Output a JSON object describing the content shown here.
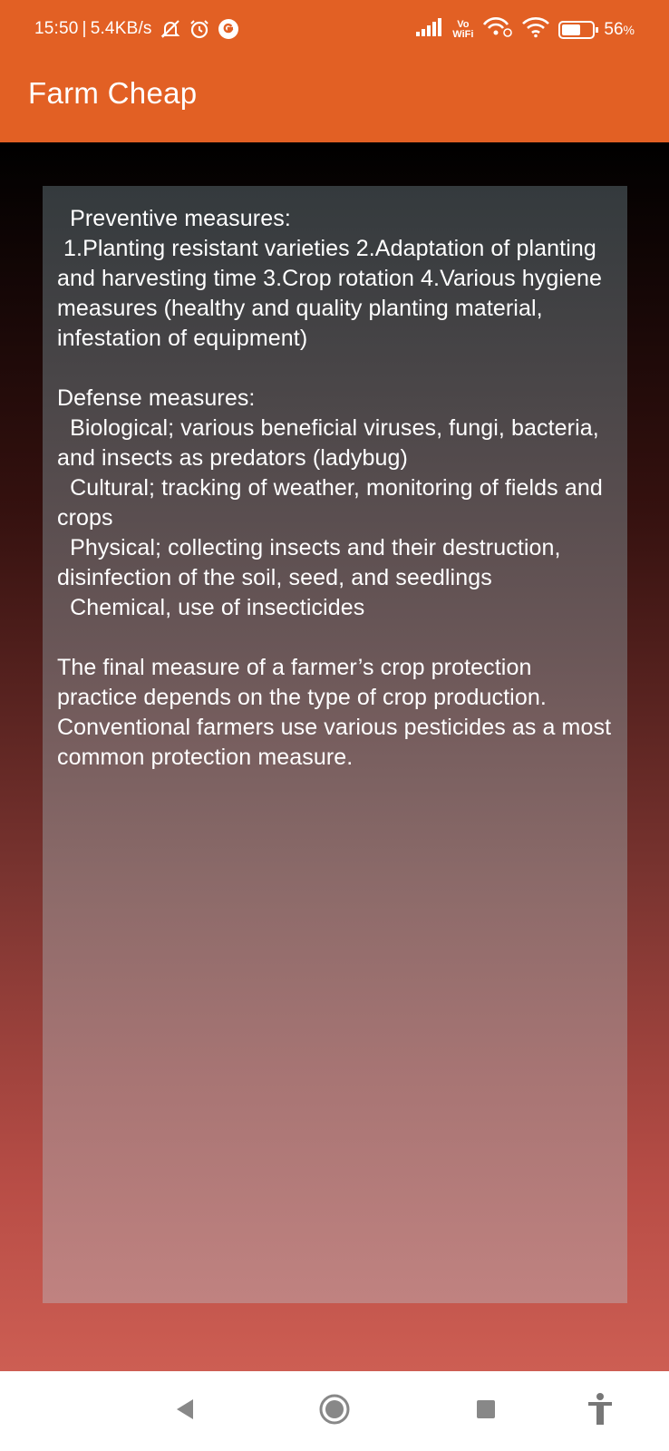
{
  "status_bar": {
    "time": "15:50",
    "separator": "|",
    "network_speed": "5.4KB/s",
    "vowifi_top": "Vo",
    "vowifi_bottom": "WiFi",
    "battery_percent": "56",
    "battery_unit": "%",
    "icons": [
      "mute-icon",
      "alarm-icon",
      "google-icon",
      "signal-icon",
      "wifi-calling-icon",
      "wifi-icon",
      "battery-icon"
    ]
  },
  "app_bar": {
    "title": "Farm Cheap"
  },
  "content": {
    "body_text": "  Preventive measures:\n 1.Planting resistant varieties 2.Adaptation of planting and harvesting time 3.Crop rotation 4.Various hygiene measures (healthy and quality planting material, infestation of equipment)\n\nDefense measures:\n  Biological; various beneficial viruses, fungi, bacteria, and insects as predators (ladybug)\n  Cultural; tracking of weather, monitoring of fields and crops\n  Physical; collecting insects and their destruction, disinfection of the soil, seed, and seedlings\n  Chemical, use of insecticides\n\nThe final measure of a farmer’s crop protection practice depends on the type of crop production. Conventional farmers use various pesticides as a most common protection measure."
  },
  "nav_bar": {
    "buttons": [
      "back-icon",
      "home-icon",
      "recents-icon",
      "accessibility-icon"
    ]
  },
  "colors": {
    "app_bar": "#E26024",
    "text": "#FFFFFF",
    "nav_bar": "#FFFFFF",
    "nav_icon": "#888888"
  }
}
